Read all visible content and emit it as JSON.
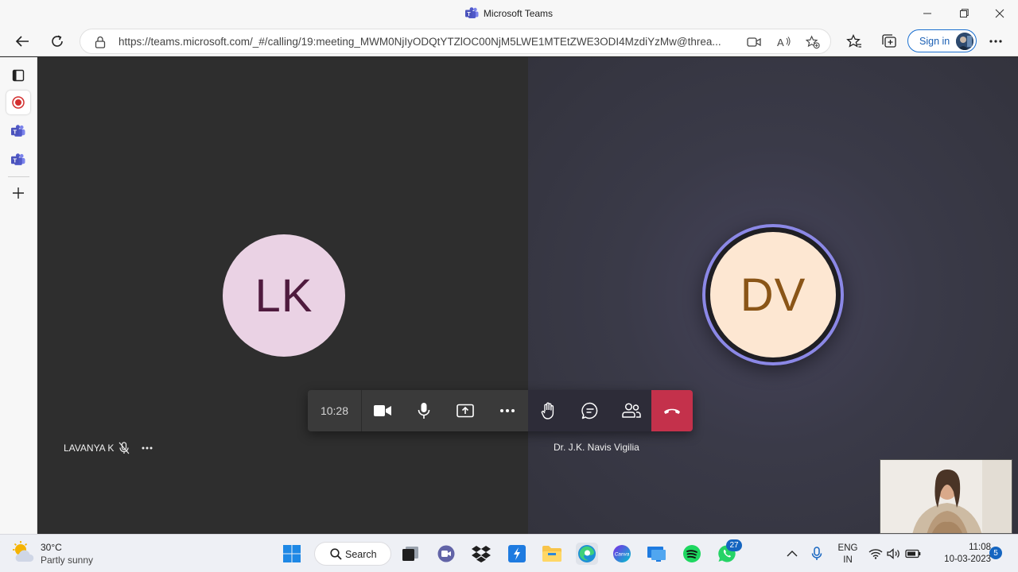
{
  "window": {
    "title": "Microsoft Teams"
  },
  "browser": {
    "url": "https://teams.microsoft.com/_#/calling/19:meeting_MWM0NjIyODQtYTZlOC00NjM5LWE1MTEtZWE3ODI4MzdiYzMw@threa...",
    "sign_in_label": "Sign in"
  },
  "call": {
    "participants": [
      {
        "initials": "LK",
        "name": "LAVANYA K",
        "muted": true
      },
      {
        "initials": "DV",
        "name": "Dr. J.K. Navis Vigilia",
        "speaking": true
      }
    ],
    "timer": "10:28",
    "controls": [
      "camera",
      "microphone",
      "share",
      "more",
      "raise-hand",
      "chat",
      "people",
      "hang-up"
    ]
  },
  "taskbar": {
    "weather": {
      "temp": "30°C",
      "condition": "Partly sunny"
    },
    "search_label": "Search",
    "whatsapp_badge": "27",
    "language": {
      "line1": "ENG",
      "line2": "IN"
    },
    "clock": {
      "time": "11:08",
      "date": "10-03-2023"
    },
    "notification_count": "5"
  },
  "colors": {
    "teams_purple": "#5b5fc7",
    "hangup_red": "#c4314b",
    "speaking_ring": "#8b88e6",
    "lk_avatar_bg": "#ead2e4",
    "dv_avatar_bg": "#fde7d2"
  }
}
